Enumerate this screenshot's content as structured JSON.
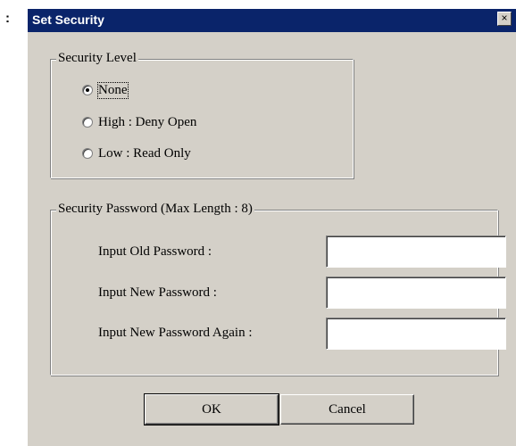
{
  "stray_text": ":",
  "window": {
    "title": "Set Security",
    "close_label": "×"
  },
  "security_level": {
    "label": "Security Level",
    "options": [
      {
        "label": "None",
        "checked": true
      },
      {
        "label": "High : Deny Open",
        "checked": false
      },
      {
        "label": "Low : Read Only",
        "checked": false
      }
    ]
  },
  "security_password": {
    "label": "Security Password (Max Length : 8)",
    "fields": [
      {
        "label": "Input Old Password :",
        "value": ""
      },
      {
        "label": "Input New Password :",
        "value": ""
      },
      {
        "label": "Input New Password Again :",
        "value": ""
      }
    ]
  },
  "buttons": {
    "ok_label": "OK",
    "cancel_label": "Cancel"
  },
  "colors": {
    "titlebar": "#0a246a",
    "dialog_bg": "#d4d0c8"
  }
}
